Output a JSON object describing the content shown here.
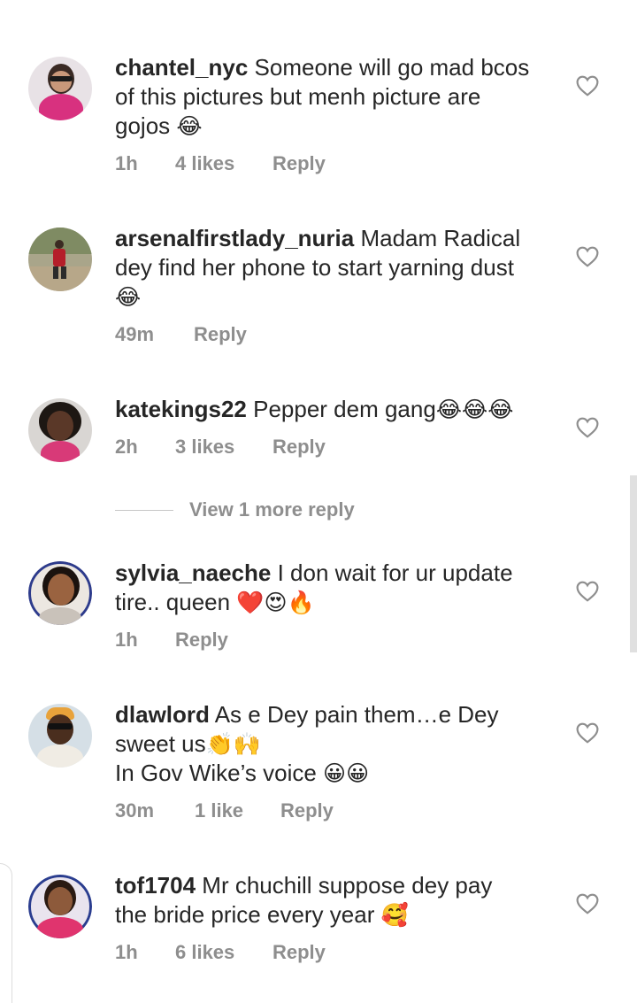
{
  "comments": [
    {
      "username": "chantel_nyc",
      "lines": [
        "Someone will go mad bcos",
        "of this pictures but menh picture are",
        "gojos "
      ],
      "emojis_line3": "😂",
      "time": "1h",
      "likes": "4 likes",
      "reply": "Reply"
    },
    {
      "username": "arsenalfirstlady_nuria",
      "lines": [
        "Madam Radical",
        "dey find her phone to start yarning dust",
        ""
      ],
      "emojis_line3": "😂",
      "time": "49m",
      "likes": "",
      "reply": "Reply"
    },
    {
      "username": "katekings22",
      "lines": [
        "Pepper dem gang"
      ],
      "emojis_line1": "😂😂😂",
      "time": "2h",
      "likes": "3 likes",
      "reply": "Reply"
    },
    {
      "username": "sylvia_naeche",
      "lines": [
        "I don wait for ur update",
        "tire.. queen "
      ],
      "emojis_line2": "❤️😍🔥",
      "time": "1h",
      "likes": "",
      "reply": "Reply"
    },
    {
      "username": "dlawlord",
      "lines": [
        "As e Dey pain them…e Dey",
        "sweet us",
        "In Gov Wike’s voice "
      ],
      "emojis_line2": "👏🙌",
      "emojis_line3": "😀😀",
      "time": "30m",
      "likes": "1 like",
      "reply": "Reply"
    },
    {
      "username": "tof1704",
      "lines": [
        "Mr chuchill suppose dey pay",
        "the bride price every year "
      ],
      "emojis_line2": "🥰",
      "time": "1h",
      "likes": "6 likes",
      "reply": "Reply"
    }
  ],
  "view_more": "View 1 more reply",
  "icons": {
    "like": "heart-outline-icon"
  },
  "colors": {
    "text": "#262626",
    "meta": "#8e8e8e",
    "divider": "#c7c7c7"
  }
}
